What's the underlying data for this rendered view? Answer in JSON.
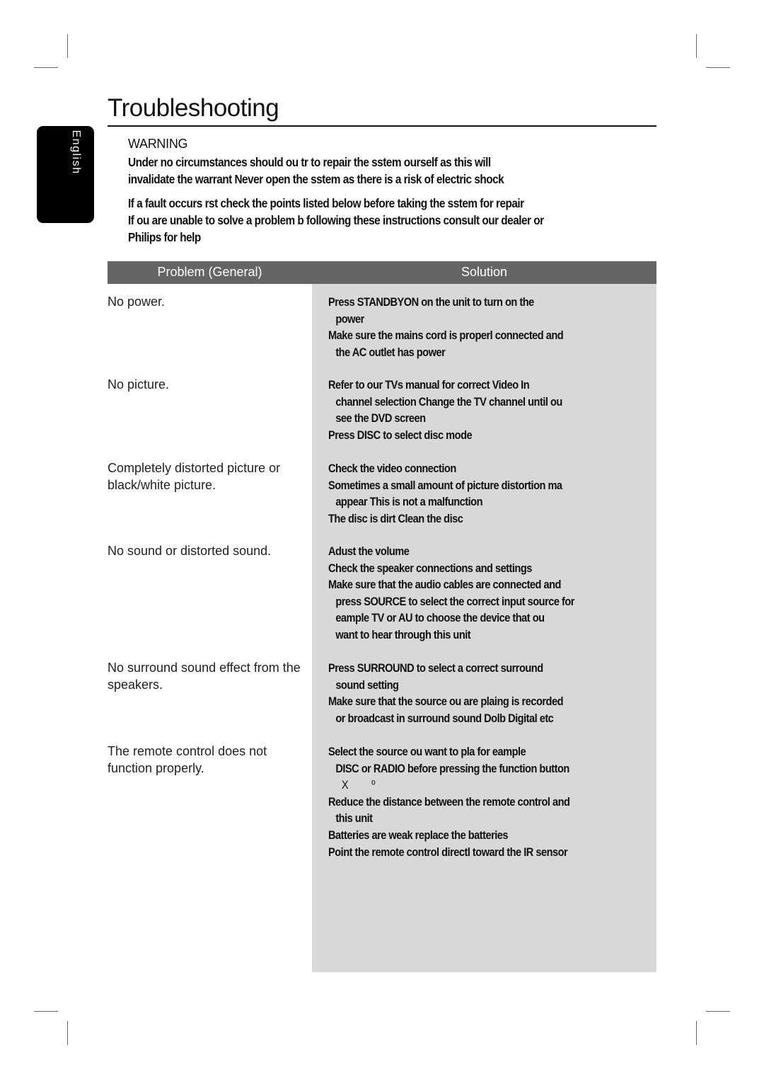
{
  "page": {
    "title": "Troubleshooting",
    "language_tab": "English"
  },
  "warning": {
    "label": "WARNING",
    "paragraph1_lines": [
      "Under no circumstances should ou tr to repair the sstem ourself as this will",
      "invalidate the warrant Never open the sstem as there is a risk of electric shock"
    ],
    "paragraph2_lines": [
      "If a fault occurs rst check the points listed below before taking the sstem for repair",
      "If ou are unable to solve a problem b following these instructions consult our dealer or",
      "Philips for help"
    ]
  },
  "table": {
    "header_problem": "Problem (General)",
    "header_solution": "Solution",
    "rows": [
      {
        "problem": "No power.",
        "solution_lines": [
          {
            "text": "Press STANDBYON on the unit to turn on the",
            "indent": false
          },
          {
            "text": "power",
            "indent": true
          },
          {
            "text": "Make sure the mains cord is properl connected and",
            "indent": false
          },
          {
            "text": "the AC outlet has power",
            "indent": true
          }
        ]
      },
      {
        "problem": "No picture.",
        "solution_lines": [
          {
            "text": "Refer to our TVs manual for correct Video In",
            "indent": false
          },
          {
            "text": "channel selection Change the TV channel until ou",
            "indent": true
          },
          {
            "text": "see the DVD screen",
            "indent": true
          },
          {
            "text": "Press DISC to select disc mode",
            "indent": false
          }
        ]
      },
      {
        "problem": "Completely distorted picture or black/white picture.",
        "solution_lines": [
          {
            "text": "Check the video connection",
            "indent": false
          },
          {
            "text": "Sometimes a small amount of picture distortion ma",
            "indent": false
          },
          {
            "text": "appear This is not a malfunction",
            "indent": true
          },
          {
            "text": "The disc is dirt Clean the disc",
            "indent": false
          }
        ]
      },
      {
        "problem": "No sound or distorted sound.",
        "solution_lines": [
          {
            "text": "Adust the volume",
            "indent": false
          },
          {
            "text": "Check the speaker connections and settings",
            "indent": false
          },
          {
            "text": "Make sure that the audio cables are connected and",
            "indent": false
          },
          {
            "text": "press SOURCE to select the correct input source for",
            "indent": true
          },
          {
            "text": "eample TV or AU to choose the device that ou",
            "indent": true
          },
          {
            "text": "want to hear through this unit",
            "indent": true
          }
        ]
      },
      {
        "problem": "No surround sound effect from the speakers.",
        "solution_lines": [
          {
            "text": "Press SURROUND to select a correct surround",
            "indent": false
          },
          {
            "text": "sound setting",
            "indent": true
          },
          {
            "text": "Make sure that the source ou are plaing is recorded",
            "indent": false
          },
          {
            "text": "or broadcast in surround sound Dolb Digital etc",
            "indent": true
          }
        ]
      },
      {
        "problem": "The remote control does not function properly.",
        "solution_lines": [
          {
            "text": "Select the source ou want to pla for eample",
            "indent": false
          },
          {
            "text": "DISC or RADIO before pressing the function button",
            "indent": true
          },
          {
            "text": "X        º",
            "indent": false,
            "symbol": true
          },
          {
            "text": "Reduce the distance between the remote control and",
            "indent": false
          },
          {
            "text": "this unit",
            "indent": true
          },
          {
            "text": "Batteries are weak replace the batteries",
            "indent": false
          },
          {
            "text": "Point the remote control directl toward the IR sensor",
            "indent": false
          }
        ]
      }
    ]
  }
}
